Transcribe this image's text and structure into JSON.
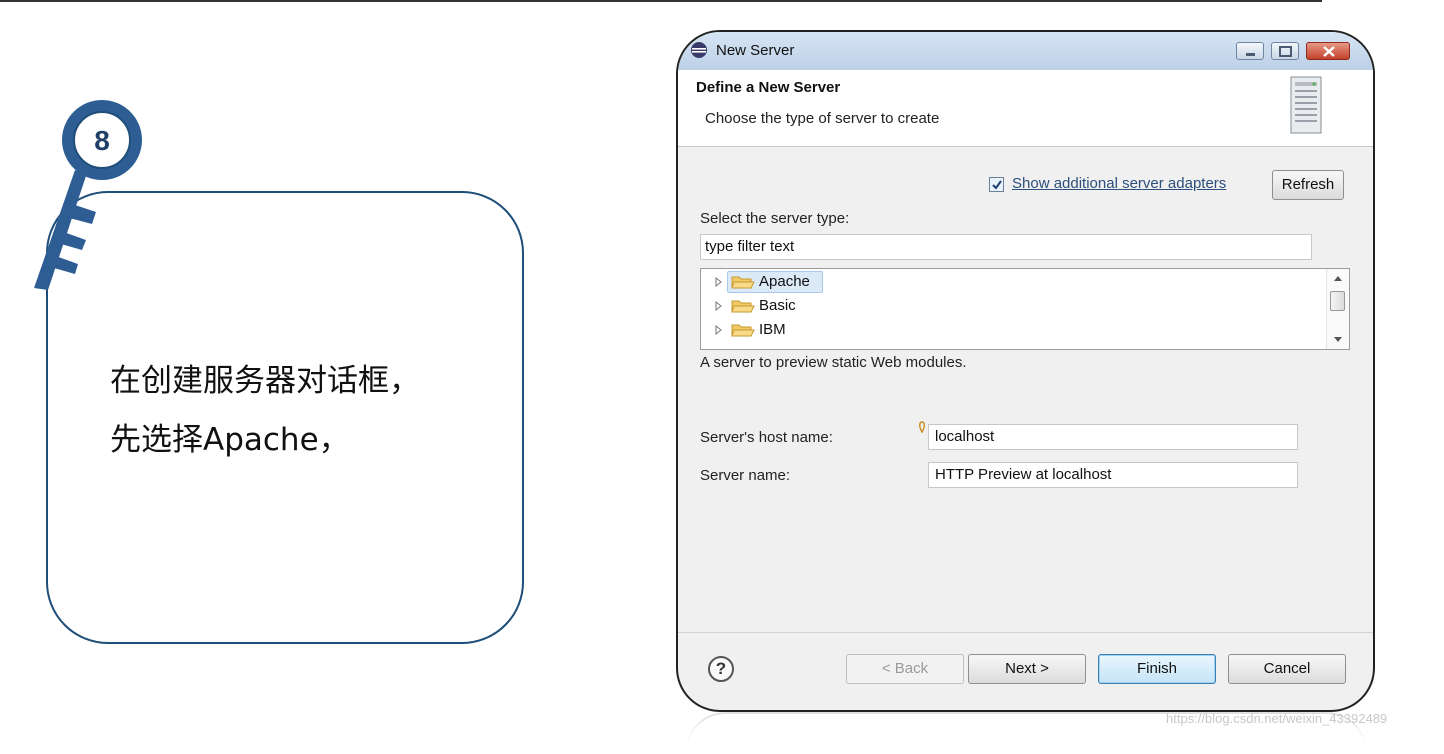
{
  "step": {
    "number": "8",
    "text": "在创建服务器对话框，\n先选择Apache，"
  },
  "dialog": {
    "window_title": "New Server",
    "wizard_title": "Define a New Server",
    "wizard_description": "Choose the type of server to create",
    "show_adapters_checked": true,
    "show_adapters_label": "Show additional server adapters",
    "refresh_label": "Refresh",
    "select_type_label": "Select the server type:",
    "filter_value": "type filter text",
    "tree_items": [
      {
        "label": "Apache",
        "selected": true
      },
      {
        "label": "Basic",
        "selected": false
      },
      {
        "label": "IBM",
        "selected": false
      }
    ],
    "description": "A server to preview static Web modules.",
    "host_name_label": "Server's host name:",
    "host_name_value": "localhost",
    "server_name_label": "Server name:",
    "server_name_value": "HTTP Preview at localhost",
    "buttons": {
      "back": "< Back",
      "next": "Next >",
      "finish": "Finish",
      "cancel": "Cancel"
    },
    "help_label": "?"
  },
  "watermark": "https://blog.csdn.net/weixin_43392489",
  "colors": {
    "callout_border": "#1f4e79",
    "key_blue": "#2e5d93",
    "link": "#2c4f7d"
  }
}
